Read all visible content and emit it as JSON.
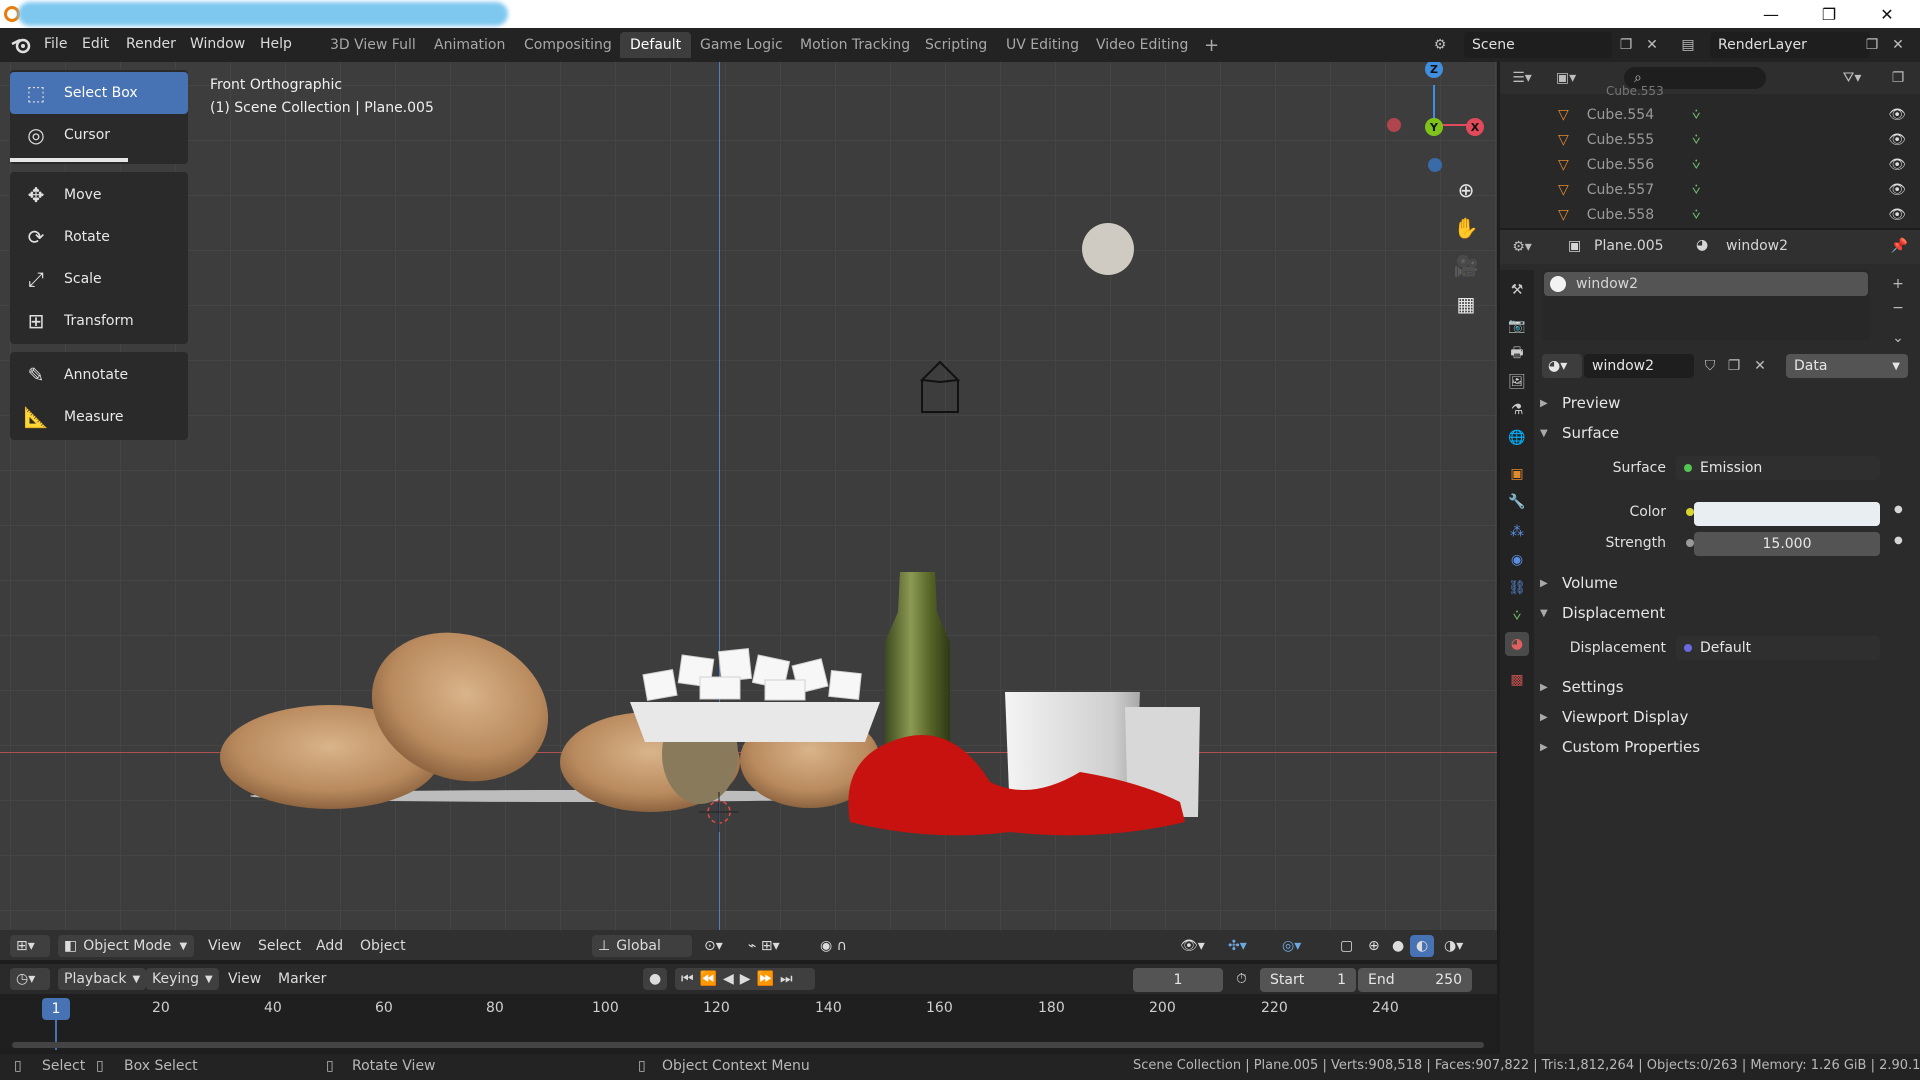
{
  "window": {
    "minimize": "—",
    "maximize": "❐",
    "close": "✕"
  },
  "menu": {
    "items": [
      "File",
      "Edit",
      "Render",
      "Window",
      "Help"
    ]
  },
  "workspaces": {
    "tabs": [
      "3D View Full",
      "Animation",
      "Compositing",
      "Default",
      "Game Logic",
      "Motion Tracking",
      "Scripting",
      "UV Editing",
      "Video Editing"
    ],
    "active": "Default",
    "add": "+"
  },
  "scene": {
    "name": "Scene",
    "view_layer": "RenderLayer"
  },
  "viewport": {
    "view_name": "Front Orthographic",
    "collection_info": "(1) Scene Collection | Plane.005",
    "gizmo": {
      "x": "X",
      "y": "Y",
      "z": "Z"
    }
  },
  "toolbar": {
    "tools": [
      "Select Box",
      "Cursor",
      "Move",
      "Rotate",
      "Scale",
      "Transform",
      "Annotate",
      "Measure"
    ],
    "active": "Select Box"
  },
  "viewport_header": {
    "mode": "Object Mode",
    "menus": [
      "View",
      "Select",
      "Add",
      "Object"
    ],
    "orientation": "Global"
  },
  "timeline": {
    "menus": [
      "Playback",
      "Keying",
      "View",
      "Marker"
    ],
    "current_frame": "1",
    "start_label": "Start",
    "start": "1",
    "end_label": "End",
    "end": "250",
    "ticks": [
      "20",
      "40",
      "60",
      "80",
      "100",
      "120",
      "140",
      "160",
      "180",
      "200",
      "220",
      "240"
    ],
    "cursor_frame": "1"
  },
  "statusbar": {
    "select": "Select",
    "box_select": "Box Select",
    "rotate_view": "Rotate View",
    "context_menu": "Object Context Menu",
    "stats": "Scene Collection | Plane.005 | Verts:908,518 | Faces:907,822 | Tris:1,812,264 | Objects:0/263 | Memory: 1.26 GiB | 2.90.1"
  },
  "outliner": {
    "partial_row": "Cube.553",
    "rows": [
      "Cube.554",
      "Cube.555",
      "Cube.556",
      "Cube.557",
      "Cube.558"
    ]
  },
  "properties": {
    "object": "Plane.005",
    "material": "window2",
    "slot": "window2",
    "material_field": "window2",
    "link": "Data",
    "sections": {
      "preview": "Preview",
      "surface": "Surface",
      "volume": "Volume",
      "displacement": "Displacement",
      "settings": "Settings",
      "viewport_display": "Viewport Display",
      "custom_properties": "Custom Properties"
    },
    "surface_label": "Surface",
    "surface_value": "Emission",
    "color_label": "Color",
    "emission_color": "#e8eef2",
    "strength_label": "Strength",
    "strength_value": "15.000",
    "displacement_label": "Displacement",
    "displacement_value": "Default"
  },
  "colors": {
    "accent": "#4772b3",
    "x_axis": "#e04a5a",
    "y_axis": "#7fc31a",
    "z_axis": "#3f8ee0"
  }
}
